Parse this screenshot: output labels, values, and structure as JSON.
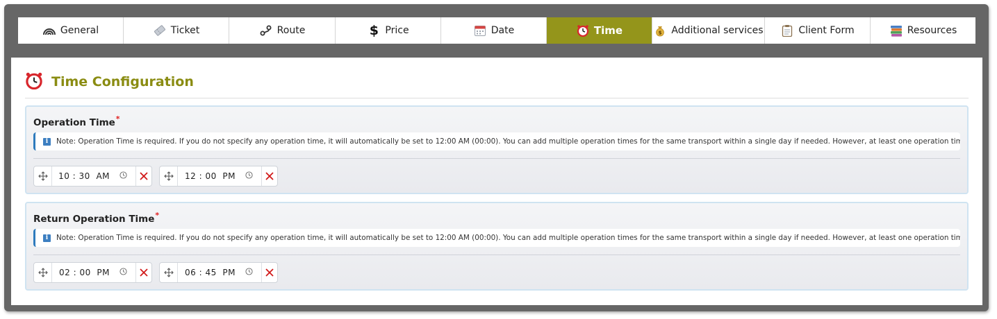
{
  "tabs": [
    {
      "label": "General",
      "icon": "rainbow-icon",
      "width": 152
    },
    {
      "label": "Ticket",
      "icon": "ticket-icon",
      "width": 152
    },
    {
      "label": "Route",
      "icon": "route-icon",
      "width": 153
    },
    {
      "label": "Price",
      "icon": "dollar-icon",
      "width": 152
    },
    {
      "label": "Date",
      "icon": "calendar-icon",
      "width": 152
    },
    {
      "label": "Time",
      "icon": "alarm-clock-icon",
      "width": 152,
      "active": true
    },
    {
      "label": "Additional services",
      "icon": "money-bag-icon",
      "width": 162
    },
    {
      "label": "Client Form",
      "icon": "clipboard-icon",
      "width": 152
    },
    {
      "label": "Resources",
      "icon": "books-icon",
      "width": 151
    }
  ],
  "panel": {
    "title": "Time Configuration",
    "title_icon": "alarm-clock-icon"
  },
  "operation_time": {
    "title": "Operation Time",
    "required_mark": "*",
    "note": "Note: Operation Time is required. If you do not specify any operation time, it will automatically be set to 12:00 AM (00:00). You can add multiple operation times for the same transport within a single day if needed. However, at least one operation time is required.",
    "times": [
      {
        "value": "10 : 30",
        "period": "AM"
      },
      {
        "value": "12 : 00",
        "period": "PM"
      }
    ]
  },
  "return_operation_time": {
    "title": "Return Operation Time",
    "required_mark": "*",
    "note": "Note: Operation Time is required. If you do not specify any operation time, it will automatically be set to 12:00 AM (00:00). You can add multiple operation times for the same transport within a single day if needed. However, at least one operation time is required.",
    "times": [
      {
        "value": "02 : 00",
        "period": "PM"
      },
      {
        "value": "06 : 45",
        "period": "PM"
      }
    ]
  },
  "colors": {
    "accent": "#94951b",
    "title": "#8a8c12",
    "frame": "#666666",
    "info": "#3d7fc1",
    "delete": "#d11a1a"
  }
}
